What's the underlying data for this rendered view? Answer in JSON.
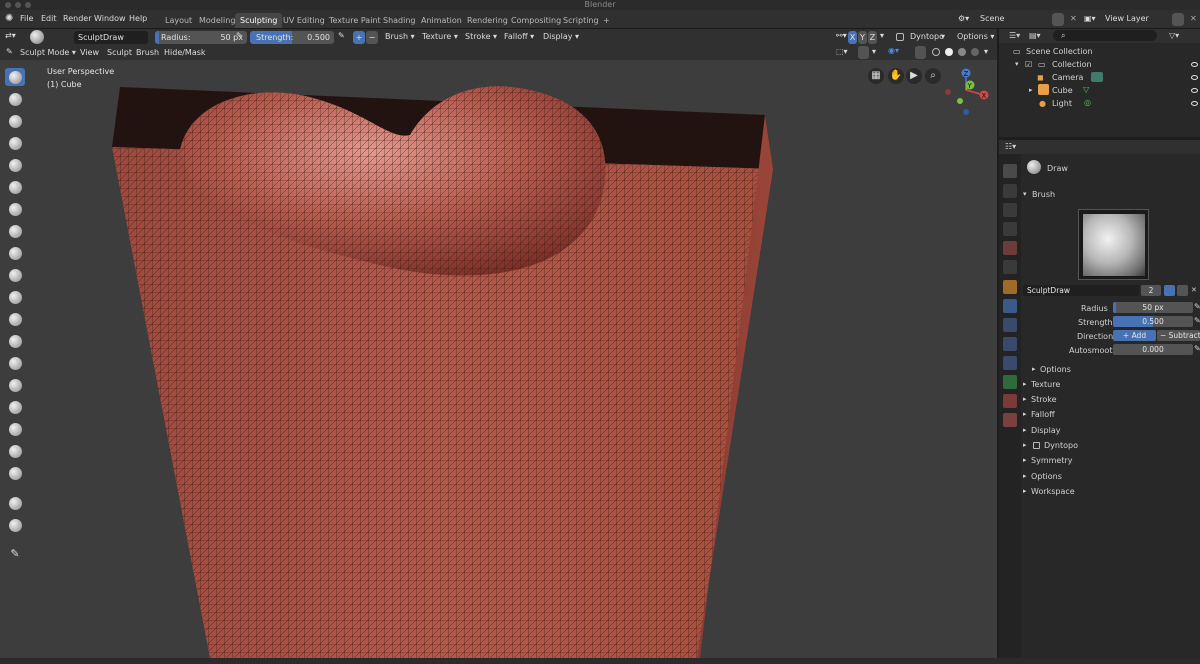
{
  "window": {
    "title": "Blender"
  },
  "menu": [
    "File",
    "Edit",
    "Render",
    "Window",
    "Help"
  ],
  "workspaces": [
    "Layout",
    "Modeling",
    "Sculpting",
    "UV Editing",
    "Texture Paint",
    "Shading",
    "Animation",
    "Rendering",
    "Compositing",
    "Scripting"
  ],
  "active_workspace": "Sculpting",
  "add_workspace": "+",
  "scene": {
    "label": "Scene",
    "view_layer": "View Layer"
  },
  "toolheader": {
    "brush_name": "SculptDraw",
    "radius_label": "Radius:",
    "radius_value": "50 px",
    "strength_label": "Strength:",
    "strength_value": "0.500",
    "plus": "+",
    "minus": "−",
    "menus": [
      "Brush",
      "Texture",
      "Stroke",
      "Falloff",
      "Display"
    ],
    "axes": [
      "X",
      "Y",
      "Z"
    ],
    "dyntopo": "Dyntopo",
    "options": "Options"
  },
  "viewhdr": {
    "mode": "Sculpt Mode",
    "menus": [
      "View",
      "Sculpt",
      "Brush",
      "Hide/Mask"
    ]
  },
  "viewport": {
    "perspective": "User Perspective",
    "object": "(1) Cube",
    "gizmo": {
      "z": "Z",
      "y": "Y",
      "x": "X"
    }
  },
  "outliner": {
    "root": "Scene Collection",
    "collection": "Collection",
    "items": [
      "Camera",
      "Cube",
      "Light"
    ]
  },
  "properties": {
    "tool": "Draw",
    "brush_section": "Brush",
    "brush_name": "SculptDraw",
    "users": "2",
    "rows": [
      {
        "label": "Radius",
        "value": "50 px"
      },
      {
        "label": "Strength",
        "value": "0.500"
      },
      {
        "label": "Autosmooth",
        "value": "0.000"
      }
    ],
    "direction": {
      "label": "Direction",
      "add": "Add",
      "subtract": "Subtract"
    },
    "options_sub": "Options",
    "sections": [
      "Texture",
      "Stroke",
      "Falloff",
      "Display",
      "Dyntopo",
      "Symmetry",
      "Options",
      "Workspace"
    ]
  },
  "colors": {
    "accent": "#4772b3",
    "mesh": "#b55a4f",
    "background": "#3d3d3d"
  }
}
